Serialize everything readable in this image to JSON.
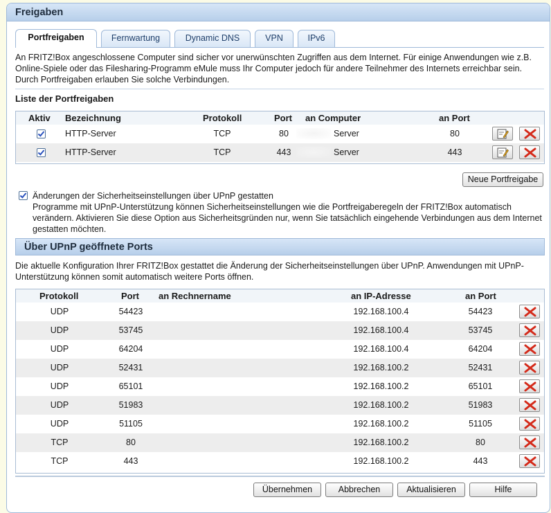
{
  "panel_title": "Freigaben",
  "tabs": [
    {
      "label": "Portfreigaben",
      "active": true
    },
    {
      "label": "Fernwartung",
      "active": false
    },
    {
      "label": "Dynamic DNS",
      "active": false
    },
    {
      "label": "VPN",
      "active": false
    },
    {
      "label": "IPv6",
      "active": false
    }
  ],
  "intro_text": "An FRITZ!Box angeschlossene Computer sind sicher vor unerwünschten Zugriffen aus dem Internet. Für einige Anwendungen wie z.B. Online-Spiele oder das Filesharing-Programm eMule muss Ihr Computer jedoch für andere Teilnehmer des Internets erreichbar sein. Durch Portfreigaben erlauben Sie solche Verbindungen.",
  "portfreigaben": {
    "title": "Liste der Portfreigaben",
    "columns": {
      "aktiv": "Aktiv",
      "bezeichnung": "Bezeichnung",
      "protokoll": "Protokoll",
      "port": "Port",
      "an_computer": "an Computer",
      "an_port": "an Port"
    },
    "rows": [
      {
        "aktiv": true,
        "bezeichnung": "HTTP-Server",
        "protokoll": "TCP",
        "port": "80",
        "an_computer": "Server",
        "an_port": "80"
      },
      {
        "aktiv": true,
        "bezeichnung": "HTTP-Server",
        "protokoll": "TCP",
        "port": "443",
        "an_computer": "Server",
        "an_port": "443"
      }
    ],
    "new_button": "Neue Portfreigabe"
  },
  "upnp_option": {
    "checked": true,
    "label": "Änderungen der Sicherheitseinstellungen über UPnP gestatten",
    "description": "Programme mit UPnP-Unterstützung können Sicherheitseinstellungen wie die Portfreigaberegeln der FRITZ!Box automatisch verändern. Aktivieren Sie diese Option aus Sicherheitsgründen nur, wenn Sie tatsächlich eingehende Verbindungen aus dem Internet gestatten möchten."
  },
  "upnp_ports": {
    "title": "Über UPnP geöffnete Ports",
    "description": "Die aktuelle Konfiguration Ihrer FRITZ!Box gestattet die Änderung der Sicherheitseinstellungen über UPnP. Anwendungen mit UPnP-Unterstützung können somit automatisch weitere Ports öffnen.",
    "columns": {
      "protokoll": "Protokoll",
      "port": "Port",
      "an_rechnername": "an Rechnername",
      "an_ip": "an IP-Adresse",
      "an_port": "an Port"
    },
    "rows": [
      {
        "protokoll": "UDP",
        "port": "54423",
        "an_rechnername": "",
        "an_ip": "192.168.100.4",
        "an_port": "54423"
      },
      {
        "protokoll": "UDP",
        "port": "53745",
        "an_rechnername": "",
        "an_ip": "192.168.100.4",
        "an_port": "53745"
      },
      {
        "protokoll": "UDP",
        "port": "64204",
        "an_rechnername": "",
        "an_ip": "192.168.100.4",
        "an_port": "64204"
      },
      {
        "protokoll": "UDP",
        "port": "52431",
        "an_rechnername": "",
        "an_ip": "192.168.100.2",
        "an_port": "52431"
      },
      {
        "protokoll": "UDP",
        "port": "65101",
        "an_rechnername": "",
        "an_ip": "192.168.100.2",
        "an_port": "65101"
      },
      {
        "protokoll": "UDP",
        "port": "51983",
        "an_rechnername": "",
        "an_ip": "192.168.100.2",
        "an_port": "51983"
      },
      {
        "protokoll": "UDP",
        "port": "51105",
        "an_rechnername": "",
        "an_ip": "192.168.100.2",
        "an_port": "51105"
      },
      {
        "protokoll": "TCP",
        "port": "80",
        "an_rechnername": "",
        "an_ip": "192.168.100.2",
        "an_port": "80"
      },
      {
        "protokoll": "TCP",
        "port": "443",
        "an_rechnername": "",
        "an_ip": "192.168.100.2",
        "an_port": "443"
      }
    ]
  },
  "footer_buttons": {
    "apply": "Übernehmen",
    "cancel": "Abbrechen",
    "refresh": "Aktualisieren",
    "help": "Hilfe"
  },
  "colors": {
    "header_gradient_top": "#d7e6f7",
    "header_gradient_bottom": "#b7cfea",
    "delete_x": "#d42a1a",
    "page_background": "#fbfbe6"
  },
  "icons": {
    "edit": "edit-icon",
    "delete": "delete-icon",
    "checkbox": "checkbox-checked"
  }
}
